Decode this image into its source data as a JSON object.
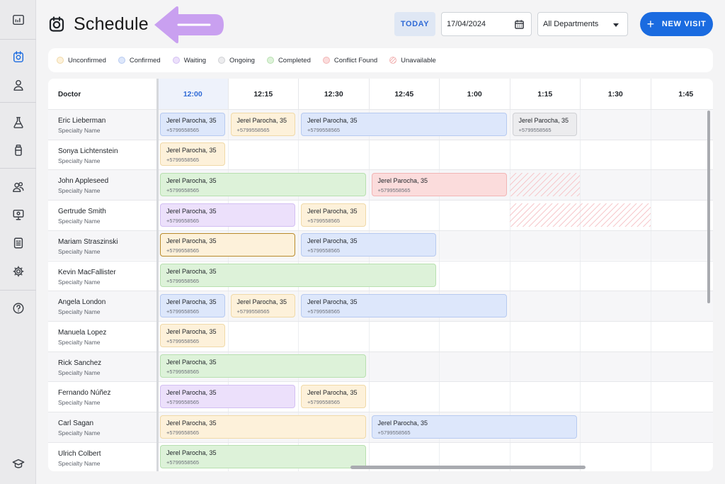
{
  "header": {
    "title": "Schedule",
    "today_label": "TODAY",
    "date_value": "17/04/2024",
    "department": "All Departments",
    "new_visit_label": "NEW VISIT"
  },
  "colors": {
    "accent": "#1a6be0",
    "unconfirmed": "#fdf1da",
    "confirmed": "#dde7fb",
    "waiting": "#ece0fb",
    "ongoing": "#ececee",
    "completed": "#ddf2d9",
    "conflict": "#fbdcdc",
    "arrow": "#c9a0f0"
  },
  "legend": [
    {
      "label": "Unconfirmed",
      "key": "unc"
    },
    {
      "label": "Confirmed",
      "key": "con"
    },
    {
      "label": "Waiting",
      "key": "wai"
    },
    {
      "label": "Ongoing",
      "key": "ong"
    },
    {
      "label": "Completed",
      "key": "com"
    },
    {
      "label": "Conflict Found",
      "key": "cnf"
    },
    {
      "label": "Unavailable",
      "key": "unav"
    }
  ],
  "sidebar": {
    "items": [
      "dashboard-icon",
      "schedule-icon",
      "user-icon",
      "flask-icon",
      "bottle-icon",
      "users-icon",
      "monitor-icon",
      "report-icon",
      "gear-icon",
      "help-icon",
      "graduation-cap-icon"
    ]
  },
  "schedule": {
    "doctor_header": "Doctor",
    "times": [
      "12:00",
      "12:15",
      "12:30",
      "12:45",
      "1:00",
      "1:15",
      "1:30",
      "1:45"
    ],
    "active_time": "12:00",
    "doctors": [
      {
        "name": "Eric Lieberman",
        "specialty": "Specialty Name"
      },
      {
        "name": "Sonya Lichtenstein",
        "specialty": "Specialty Name"
      },
      {
        "name": "John Appleseed",
        "specialty": "Specialty Name"
      },
      {
        "name": "Gertrude Smith",
        "specialty": "Specialty Name"
      },
      {
        "name": "Mariam Straszinski",
        "specialty": "Specialty Name"
      },
      {
        "name": "Kevin MacFallister",
        "specialty": "Specialty Name"
      },
      {
        "name": "Angela London",
        "specialty": "Specialty Name"
      },
      {
        "name": "Manuela Lopez",
        "specialty": "Specialty Name"
      },
      {
        "name": "Rick Sanchez",
        "specialty": "Specialty Name"
      },
      {
        "name": "Fernando Núñez",
        "specialty": "Specialty Name"
      },
      {
        "name": "Carl Sagan",
        "specialty": "Specialty Name"
      },
      {
        "name": "Ulrich Colbert",
        "specialty": "Specialty Name"
      }
    ],
    "patient_name": "Jerel Parocha, 35",
    "patient_phone": "+5799558565",
    "appointments": [
      {
        "row": 0,
        "start": 0,
        "span": 1,
        "status": "con"
      },
      {
        "row": 0,
        "start": 1,
        "span": 1,
        "status": "unc"
      },
      {
        "row": 0,
        "start": 2,
        "span": 3,
        "status": "con"
      },
      {
        "row": 0,
        "start": 5,
        "span": 1,
        "status": "ong"
      },
      {
        "row": 1,
        "start": 0,
        "span": 1,
        "status": "unc"
      },
      {
        "row": 2,
        "start": 0,
        "span": 3,
        "status": "com"
      },
      {
        "row": 2,
        "start": 3,
        "span": 2,
        "status": "cnf"
      },
      {
        "row": 3,
        "start": 0,
        "span": 2,
        "status": "wai"
      },
      {
        "row": 3,
        "start": 2,
        "span": 1,
        "status": "unc"
      },
      {
        "row": 4,
        "start": 0,
        "span": 2,
        "status": "unc",
        "selected": true
      },
      {
        "row": 4,
        "start": 2,
        "span": 2,
        "status": "con"
      },
      {
        "row": 5,
        "start": 0,
        "span": 4,
        "status": "com"
      },
      {
        "row": 6,
        "start": 0,
        "span": 1,
        "status": "con"
      },
      {
        "row": 6,
        "start": 1,
        "span": 1,
        "status": "unc"
      },
      {
        "row": 6,
        "start": 2,
        "span": 3,
        "status": "con"
      },
      {
        "row": 7,
        "start": 0,
        "span": 1,
        "status": "unc"
      },
      {
        "row": 8,
        "start": 0,
        "span": 3,
        "status": "com"
      },
      {
        "row": 9,
        "start": 0,
        "span": 2,
        "status": "wai"
      },
      {
        "row": 9,
        "start": 2,
        "span": 1,
        "status": "unc"
      },
      {
        "row": 10,
        "start": 0,
        "span": 3,
        "status": "unc"
      },
      {
        "row": 10,
        "start": 3,
        "span": 3,
        "status": "con"
      },
      {
        "row": 11,
        "start": 0,
        "span": 3,
        "status": "com"
      }
    ],
    "unavailable": [
      {
        "row": 2,
        "start": 5,
        "span": 1
      },
      {
        "row": 3,
        "start": 5,
        "span": 2
      }
    ]
  }
}
